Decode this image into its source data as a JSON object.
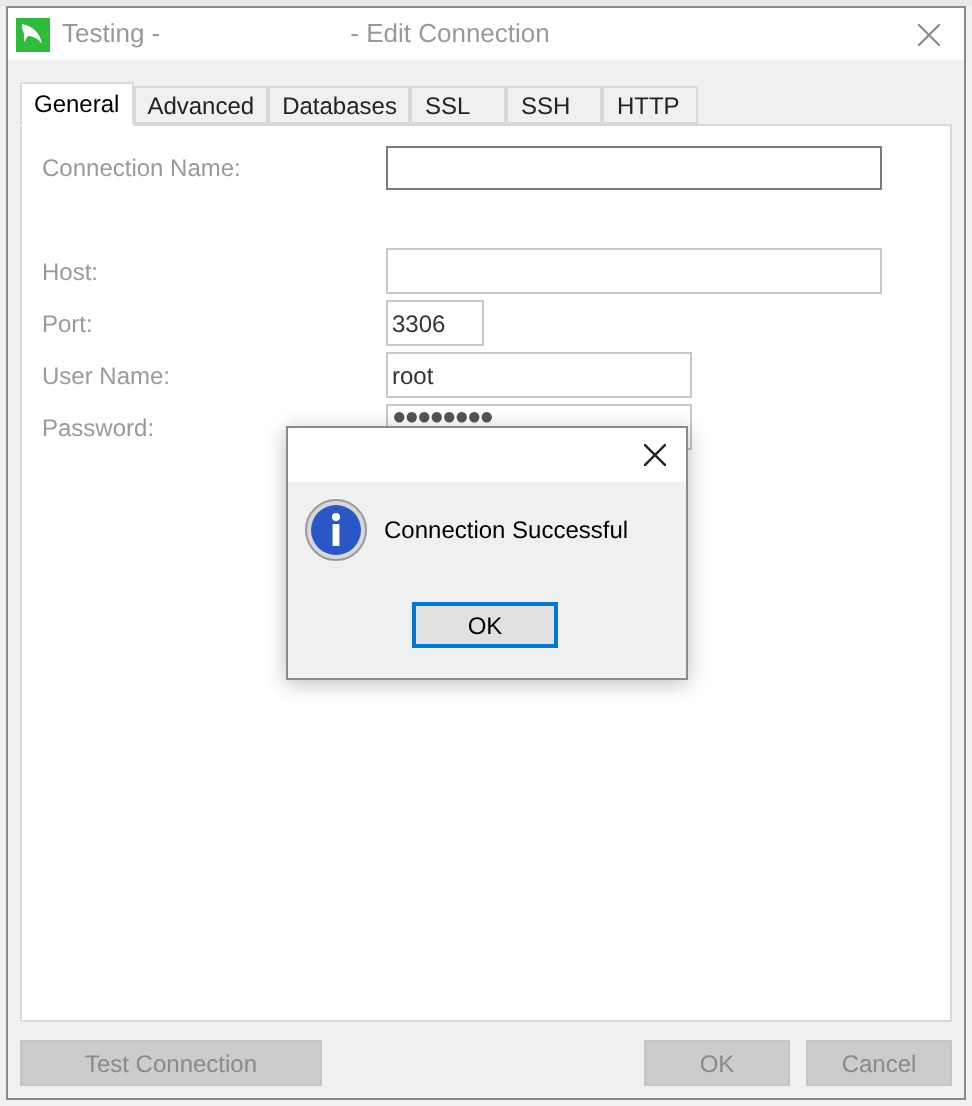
{
  "window": {
    "title_start": "Testing -",
    "title_end": "- Edit Connection"
  },
  "tabs": [
    {
      "label": "General",
      "selected": true
    },
    {
      "label": "Advanced",
      "selected": false
    },
    {
      "label": "Databases",
      "selected": false
    },
    {
      "label": "SSL",
      "selected": false
    },
    {
      "label": "SSH",
      "selected": false
    },
    {
      "label": "HTTP",
      "selected": false
    }
  ],
  "fields": [
    {
      "label": "Connection Name:",
      "kind": "name"
    },
    {
      "label": "Host:",
      "kind": "wide"
    },
    {
      "label": "Port:",
      "kind": "short",
      "value": "3306"
    },
    {
      "label": "User Name:",
      "kind": "medium",
      "value": "root"
    },
    {
      "label": "Password:",
      "kind": "medium",
      "value": "●●●●●●●●"
    }
  ],
  "message_box": {
    "text": "Connection Successful",
    "button": {
      "label": "OK",
      "focused": true
    }
  },
  "buttons": [
    {
      "label": "Test Connection",
      "disabled": true,
      "kind": "left"
    },
    {
      "label": "OK",
      "disabled": true,
      "kind": "right"
    },
    {
      "label": "Cancel",
      "disabled": true,
      "kind": "right"
    }
  ]
}
